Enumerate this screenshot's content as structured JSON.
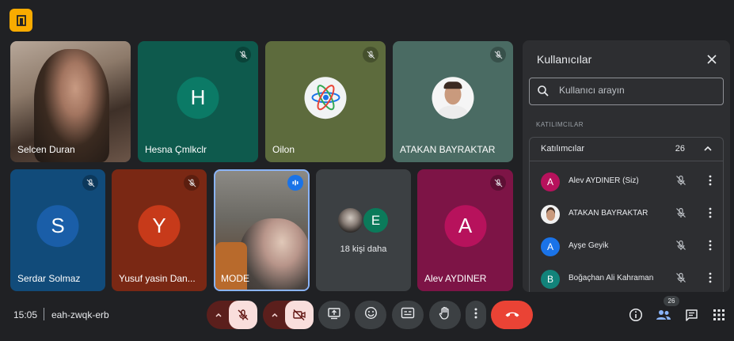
{
  "tiles": [
    {
      "name": "Selcen Duran",
      "type": "video"
    },
    {
      "name": "Hesna Çmlkclr",
      "initial": "H",
      "color": "#0b6e5f",
      "bg": "#0e5a4d"
    },
    {
      "name": "Oilon",
      "type": "logo",
      "bg": "#5d6b3d"
    },
    {
      "name": "ATAKAN BAYRAKTAR",
      "type": "photo",
      "bg": "#4a6b63"
    },
    {
      "name": "Serdar Solmaz",
      "initial": "S",
      "color": "#1a5ea8",
      "bg": "#114b7a"
    },
    {
      "name": "Yusuf yasin Dan...",
      "initial": "Y",
      "color": "#c73a1a",
      "bg": "#7a2814"
    },
    {
      "name": "MODE",
      "type": "video"
    },
    {
      "name": "18 kişi daha",
      "type": "more",
      "initial": "E",
      "color": "#0b7a5a"
    },
    {
      "name": "Alev AYDINER",
      "initial": "A",
      "color": "#b7125c",
      "bg": "#7d1446"
    }
  ],
  "panel": {
    "title": "Kullanıcılar",
    "search_placeholder": "Kullanıcı arayın",
    "section_label": "KATILIMCILAR",
    "group_title": "Katılımcılar",
    "group_count": "26",
    "participants": [
      {
        "name": "Alev AYDINER (Siz)",
        "initial": "A",
        "color": "#b7125c"
      },
      {
        "name": "ATAKAN BAYRAKTAR",
        "type": "photo"
      },
      {
        "name": "Ayşe Geyik",
        "initial": "A",
        "color": "#1a73e8"
      },
      {
        "name": "Boğaçhan Ali Kahraman",
        "initial": "B",
        "color": "#12837a"
      }
    ]
  },
  "bottom": {
    "time": "15:05",
    "meeting_code": "eah-zwqk-erb",
    "people_badge": "26"
  },
  "icons": [
    "door-icon",
    "mic-off-icon",
    "cam-off-icon",
    "present-icon",
    "emoji-icon",
    "captions-icon",
    "hand-icon",
    "more-icon",
    "end-call-icon",
    "info-icon",
    "people-icon",
    "chat-icon",
    "apps-icon",
    "search-icon",
    "close-icon",
    "chevron-up-icon",
    "speaking-icon"
  ]
}
